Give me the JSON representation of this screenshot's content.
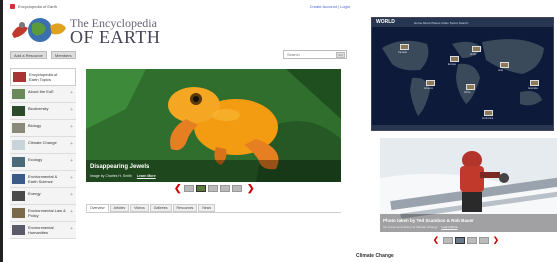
{
  "topbar": {
    "site_name": "Encyclopedia of Earth",
    "account_links": "Create Account | Login"
  },
  "logo": {
    "line1": "The Encyclopedia",
    "line2": "OF EARTH"
  },
  "nav": {
    "buttons": [
      "Add a Resource",
      "Members"
    ]
  },
  "search": {
    "placeholder": "Search",
    "go_label": "GO"
  },
  "sidebar": {
    "items": [
      {
        "label": "Encyclopedia of Earth Topics",
        "active": true
      },
      {
        "label": "About the EoE"
      },
      {
        "label": "Biodiversity"
      },
      {
        "label": "Biology"
      },
      {
        "label": "Climate Change"
      },
      {
        "label": "Ecology"
      },
      {
        "label": "Environmental & Earth Science"
      },
      {
        "label": "Energy"
      },
      {
        "label": "Environmental Law & Policy"
      },
      {
        "label": "Environmental Humanities"
      }
    ],
    "plus_label": "+"
  },
  "feature": {
    "title": "Disappearing Jewels",
    "credit": "Image by Charles H. Smith",
    "learn_more": "Learn More",
    "thumb_count": 6,
    "selected_thumb": 1
  },
  "tabs": [
    "Overview",
    "Articles",
    "Videos",
    "Galleries",
    "Resources",
    "News"
  ],
  "map": {
    "logo": "WORLD",
    "nav": "Home   About   Places   Cities   Topics   Search",
    "pins": [
      {
        "label": "Antarctica"
      },
      {
        "label": "Arctic"
      },
      {
        "label": "Canada"
      },
      {
        "label": "Amazon"
      },
      {
        "label": "Africa"
      },
      {
        "label": "Asia"
      },
      {
        "label": "Europe"
      },
      {
        "label": "Australia"
      }
    ]
  },
  "photo2": {
    "title": "Photo taken by Ted Scambos & Rob Bauer",
    "subtitle": "Ice Cores and History of Climate Change",
    "learn_more": "Learn More"
  },
  "climate_heading": "Climate Change",
  "colors": {
    "arrow": "#cc0000",
    "feature_bg": "#2d6b2b",
    "map_bg": "#0e1a3a"
  }
}
